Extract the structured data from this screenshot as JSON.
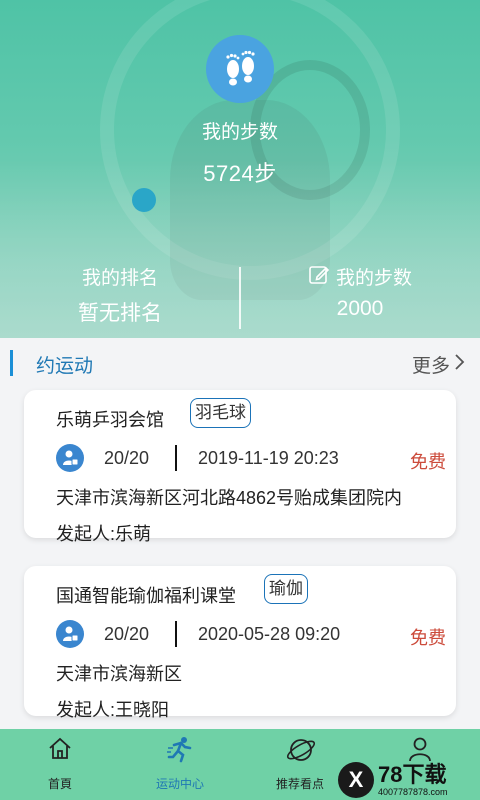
{
  "header": {
    "steps_title": "我的步数",
    "steps_value": "5724步",
    "icon": "footprints-icon",
    "stats": {
      "rank_label": "我的排名",
      "rank_value": "暂无排名",
      "goal_label": "我的步数",
      "goal_value": "2000",
      "goal_icon": "edit-icon"
    }
  },
  "section": {
    "title": "约运动",
    "more_label": "更多"
  },
  "events": [
    {
      "name": "乐萌乒羽会馆",
      "tag": "羽毛球",
      "count": "20/20",
      "datetime": "2019-11-19 20:23",
      "fee": "免费",
      "address": "天津市滨海新区河北路4862号贻成集团院内",
      "initiator": "发起人:乐萌"
    },
    {
      "name": "国通智能瑜伽福利课堂",
      "tag": "瑜伽",
      "count": "20/20",
      "datetime": "2020-05-28 09:20",
      "fee": "免费",
      "address": "天津市滨海新区",
      "initiator": "发起人:王晓阳"
    }
  ],
  "nav": [
    {
      "label": "首頁",
      "icon": "home-icon"
    },
    {
      "label": "运动中心",
      "icon": "running-icon",
      "active": true
    },
    {
      "label": "推荐看点",
      "icon": "planet-icon"
    },
    {
      "label": "",
      "icon": "user-icon"
    }
  ],
  "watermark": {
    "brand": "78下载",
    "phone": "4007787878.com"
  },
  "colors": {
    "accent": "#1f78b4",
    "fee": "#cc4b3b",
    "nav_bg": "#6fd1a6"
  }
}
